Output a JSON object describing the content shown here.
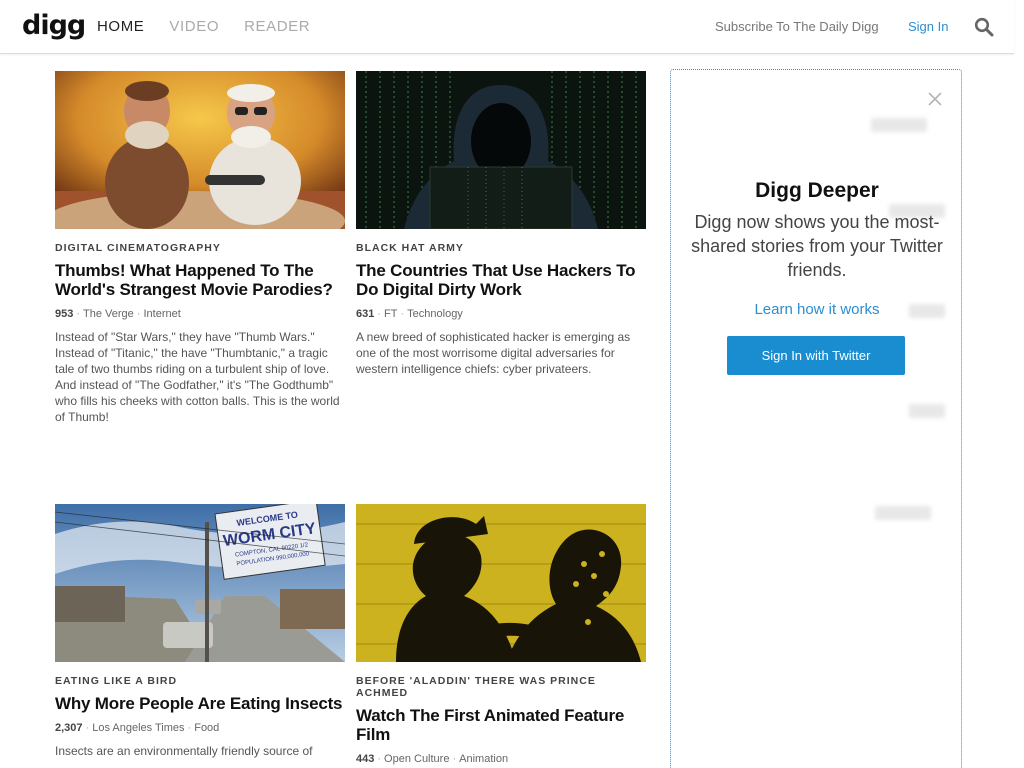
{
  "header": {
    "logo": "digg",
    "nav": [
      "HOME",
      "VIDEO",
      "READER"
    ],
    "subscribe": "Subscribe To The Daily Digg",
    "signin": "Sign In",
    "search_icon": "search-icon"
  },
  "stories": [
    {
      "kicker": "DIGITAL CINEMATOGRAPHY",
      "title": "Thumbs! What Happened To The World's Strangest Movie Parodies?",
      "count": "953",
      "source": "The Verge",
      "category": "Internet",
      "desc": "Instead of \"Star Wars,\" they have \"Thumb Wars.\" Instead of \"Titanic,\" the have \"Thumbtanic,\" a tragic tale of two thumbs riding on a turbulent ship of love. And instead of \"The Godfather,\" it's \"The Godthumb\" who fills his cheeks with cotton balls. This is the world of Thumb!"
    },
    {
      "kicker": "BLACK HAT ARMY",
      "title": "The Countries That Use Hackers To Do Digital Dirty Work",
      "count": "631",
      "source": "FT",
      "category": "Technology",
      "desc": "A new breed of sophisticated hacker is emerging as one of the most worrisome digital adversaries for western intelligence chiefs: cyber privateers."
    },
    {
      "kicker": "EATING LIKE A BIRD",
      "title": "Why More People Are Eating Insects",
      "count": "2,307",
      "source": "Los Angeles Times",
      "category": "Food",
      "desc": "Insects are an environmentally friendly source of"
    },
    {
      "kicker": "BEFORE 'ALADDIN' THERE WAS PRINCE ACHMED",
      "title": "Watch The First Animated Feature Film",
      "count": "443",
      "source": "Open Culture",
      "category": "Animation",
      "desc": ""
    }
  ],
  "thumb_texts": {
    "sign_line1": "WELCOME TO",
    "sign_line2": "WORM CITY",
    "sign_line3": "COMPTON, CAL 90220 1/2",
    "sign_line4": "POPULATION 990,000,000"
  },
  "sidebar": {
    "title": "Digg Deeper",
    "text": "Digg now shows you the most-shared stories from your Twitter friends.",
    "learn": "Learn how it works",
    "button": "Sign In with Twitter",
    "close_icon": "close-icon"
  },
  "colors": {
    "accent": "#1a8cd0",
    "link": "#2b8ed0"
  }
}
